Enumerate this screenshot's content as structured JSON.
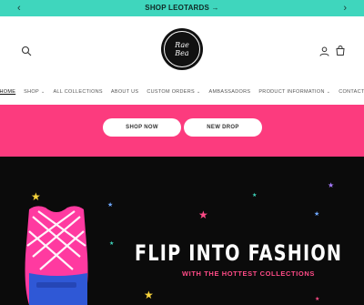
{
  "announcement": {
    "message": "SHOP LEOTARDS →",
    "prev_icon": "chevron-left-icon",
    "next_icon": "chevron-right-icon"
  },
  "header": {
    "logo": {
      "line1": "Rae",
      "line2": "Bea"
    },
    "icons": [
      "search-icon",
      "account-icon",
      "cart-icon"
    ]
  },
  "nav": {
    "items": [
      {
        "label": "HOME",
        "dropdown": false,
        "active": true
      },
      {
        "label": "SHOP",
        "dropdown": true,
        "active": false
      },
      {
        "label": "ALL COLLECTIONS",
        "dropdown": false,
        "active": false
      },
      {
        "label": "ABOUT US",
        "dropdown": false,
        "active": false
      },
      {
        "label": "CUSTOM ORDERS",
        "dropdown": true,
        "active": false
      },
      {
        "label": "AMBASSADORS",
        "dropdown": false,
        "active": false
      },
      {
        "label": "PRODUCT INFORMATION",
        "dropdown": true,
        "active": false
      },
      {
        "label": "CONTACT",
        "dropdown": false,
        "active": false
      }
    ]
  },
  "buttons": {
    "shop_now": "SHOP NOW",
    "new_drop": "NEW DROP"
  },
  "hero": {
    "title": "FLIP INTO FASHION",
    "subtitle": "WITH THE HOTTEST COLLECTIONS"
  },
  "colors": {
    "announcement_bg": "#3fd6bd",
    "pink": "#fc3b7e",
    "hero_bg": "#0b0b0b",
    "subtitle": "#ff4b87"
  }
}
